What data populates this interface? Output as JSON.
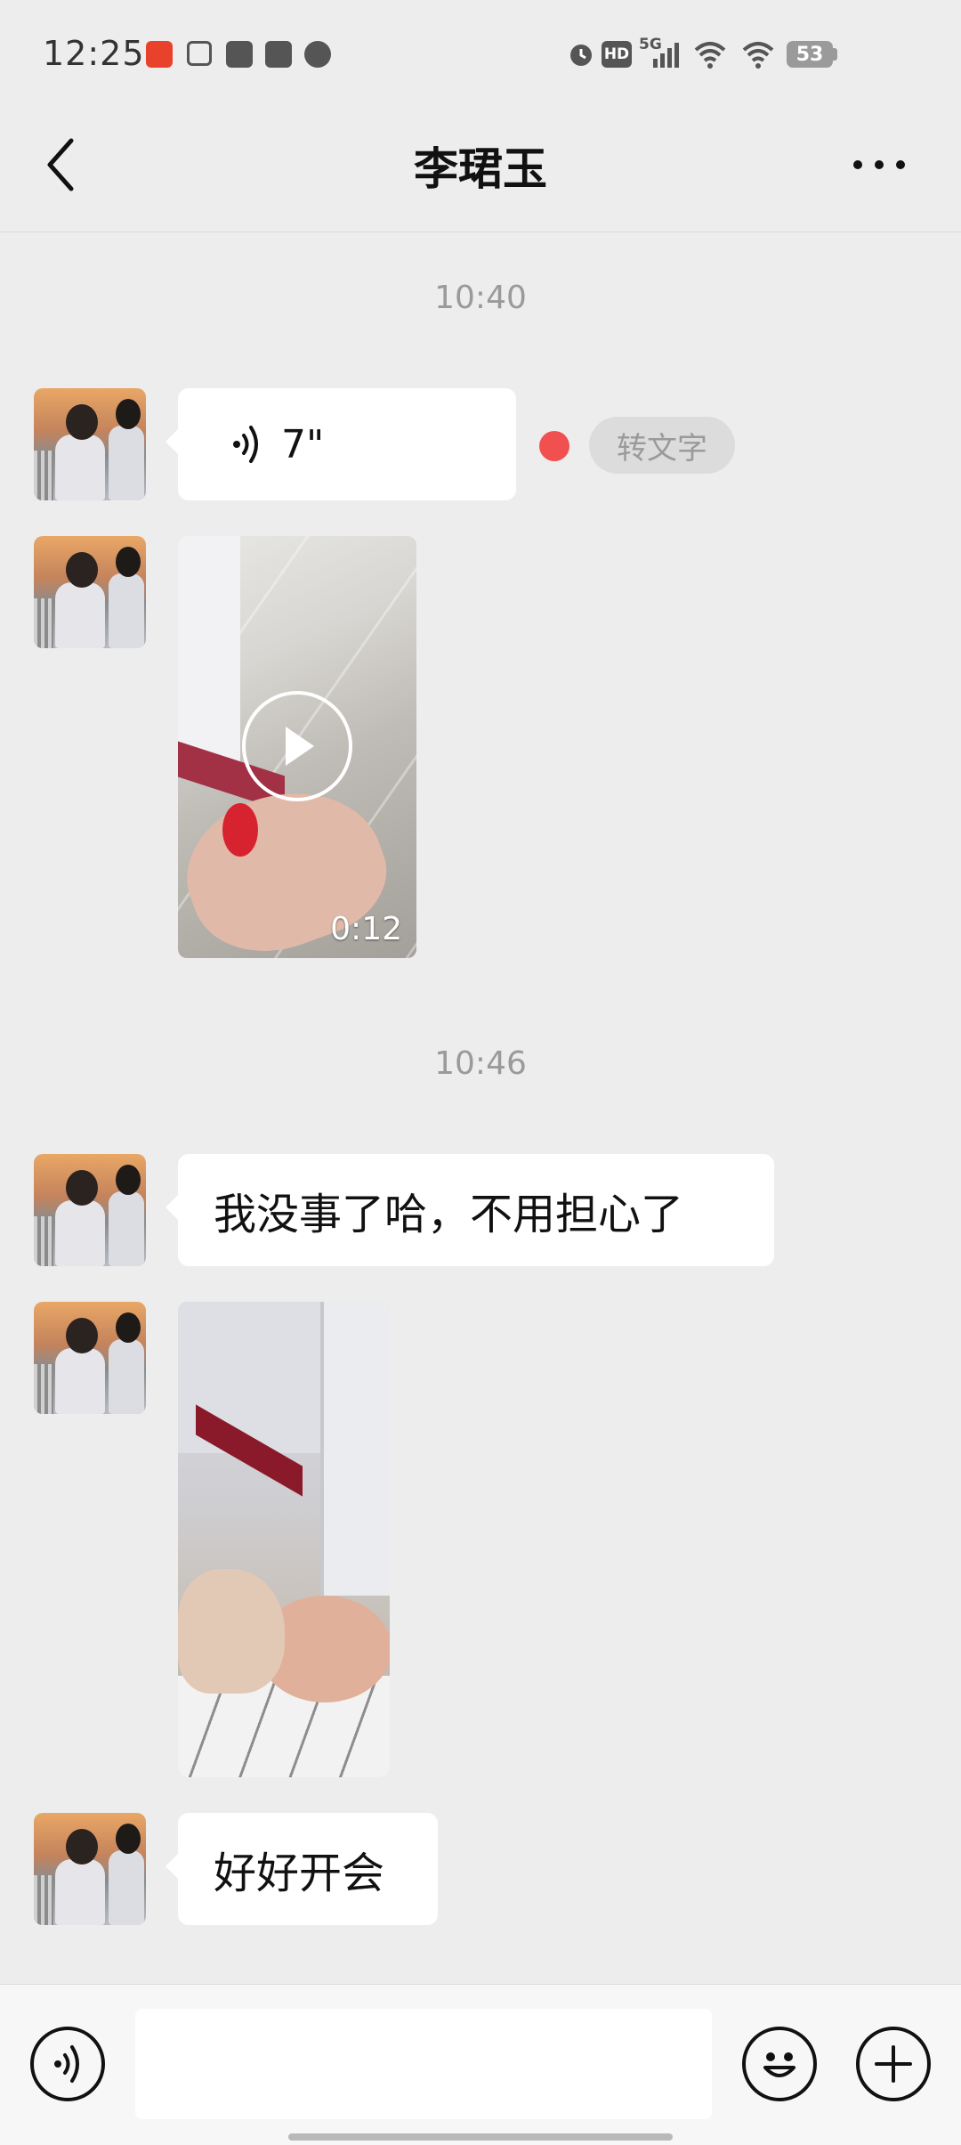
{
  "status_bar": {
    "time": "12:25",
    "network": "5G",
    "battery": "53",
    "app_icons": [
      "ting-app-icon",
      "calendar-app-icon",
      "mail-app-icon",
      "square-app-icon",
      "wechat-app-icon"
    ],
    "hd_label": "HD"
  },
  "header": {
    "title": "李珺玉"
  },
  "messages": {
    "time_1": "10:40",
    "voice_duration": "7\"",
    "to_text_label": "转文字",
    "video_1_duration": "0:12",
    "time_2": "10:46",
    "text_1": "我没事了哈，不用担心了",
    "text_2": "好好开会"
  },
  "colors": {
    "background": "#ededed",
    "bubble": "#ffffff",
    "unread_dot": "#f15050",
    "timestamp": "#9a9a9a"
  }
}
